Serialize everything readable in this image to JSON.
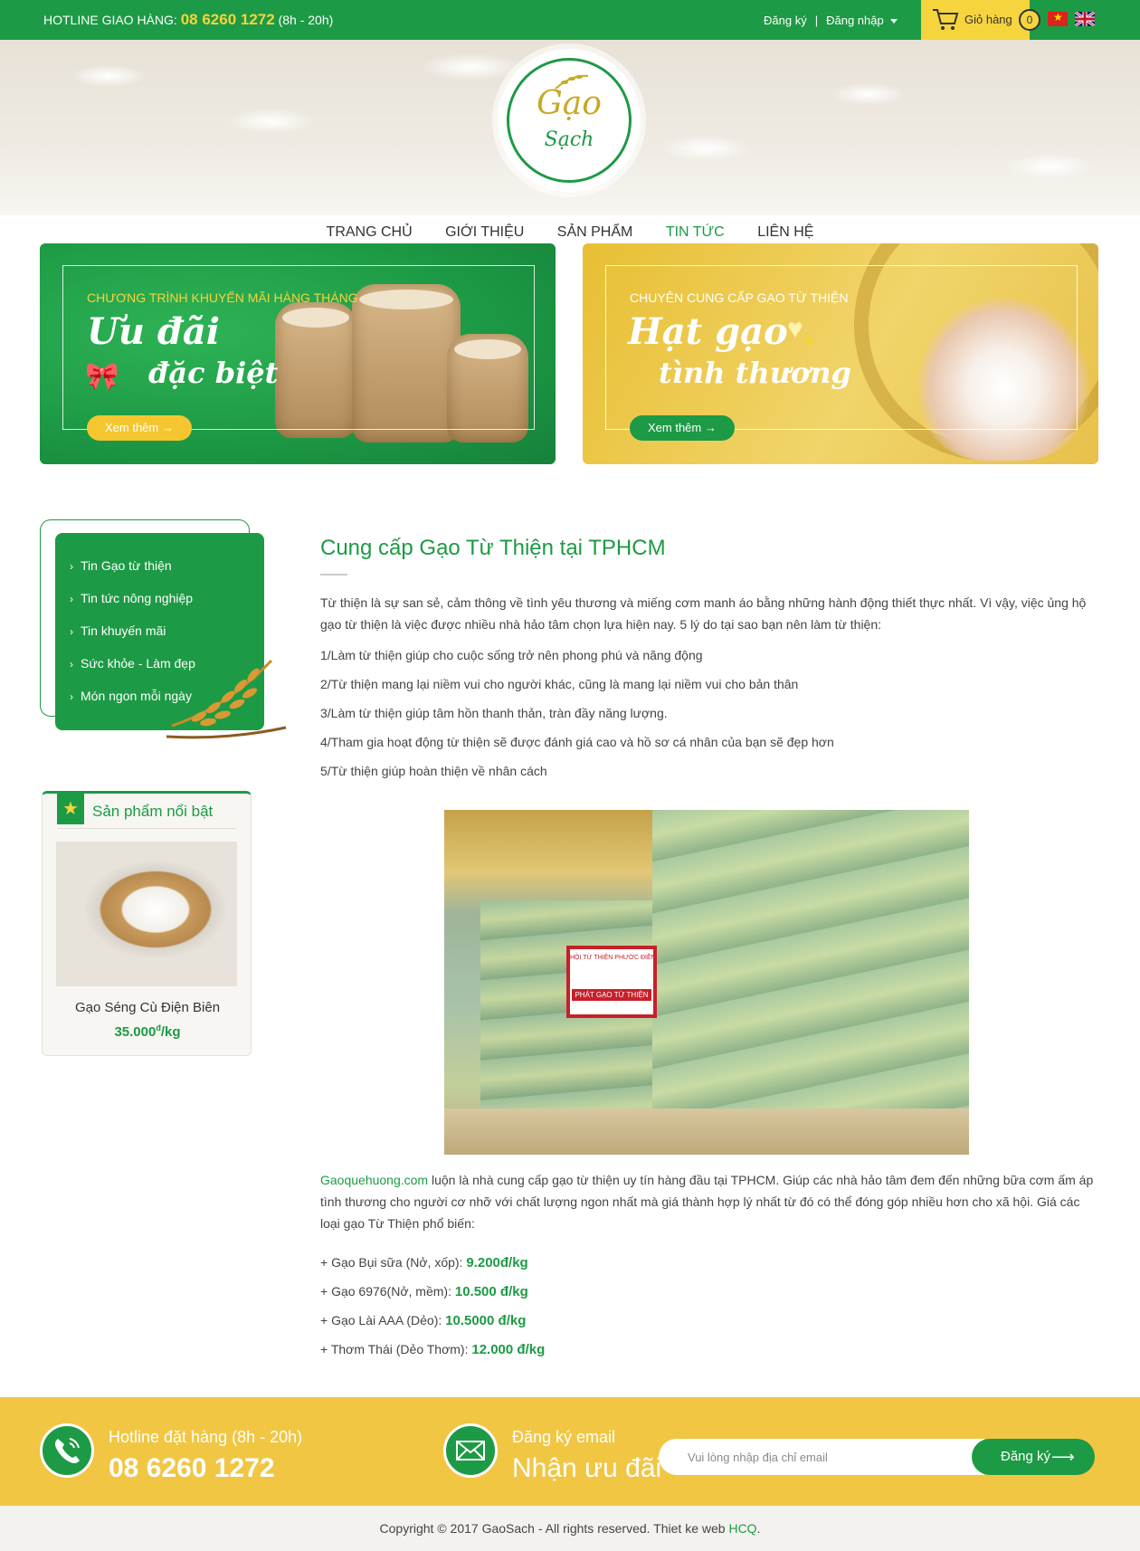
{
  "topbar": {
    "hotline_label": "HOTLINE GIAO HÀNG:",
    "hotline_number": "08 6260 1272",
    "hotline_hours": "(8h - 20h)",
    "register": "Đăng ký",
    "separator": "|",
    "login": "Đăng nhập",
    "cart_label": "Giỏ hàng",
    "cart_count": "0",
    "flag_icons": [
      "vietnam-flag-icon",
      "uk-flag-icon"
    ]
  },
  "logo": {
    "line1": "Gạo",
    "line2": "Sạch"
  },
  "nav": [
    {
      "label": "TRANG CHỦ",
      "active": false
    },
    {
      "label": "GIỚI THIỆU",
      "active": false
    },
    {
      "label": "SẢN PHẨM",
      "active": false
    },
    {
      "label": "TIN TỨC",
      "active": true
    },
    {
      "label": "LIÊN HỆ",
      "active": false
    }
  ],
  "banners": {
    "left": {
      "kicker": "CHƯƠNG TRÌNH KHUYẾN MÃI HÀNG THÁNG",
      "line1": "Ưu đãi",
      "line2": "đặc biệt",
      "button": "Xem thêm →"
    },
    "right": {
      "kicker": "CHUYÊN CUNG CẤP GẠO TỪ THIỆN",
      "line1": "Hạt gạo",
      "line2": "tình thương",
      "button": "Xem thêm →"
    }
  },
  "sidebar": {
    "menu": [
      "Tin Gạo từ thiện",
      "Tin tức nông nghiệp",
      "Tin khuyến mãi",
      "Sức khỏe - Làm đẹp",
      "Món ngon mỗi ngày"
    ],
    "featured": {
      "title": "Sản phẩm nổi bật",
      "product_name": "Gạo Séng Cù Điện Biên",
      "price": "35.000",
      "currency": "đ",
      "unit": "/kg"
    }
  },
  "article": {
    "title": "Cung cấp Gạo Từ Thiện tại TPHCM",
    "intro": "Từ thiện là sự san sẻ, cảm thông về tình yêu thương và miếng cơm manh áo bằng những hành động thiết thực nhất. Vì vậy, việc ủng hộ gạo từ thiện là việc được nhiều nhà hảo tâm chọn lựa hiện nay. 5 lý do tại sao bạn nên làm từ thiện:",
    "reasons": [
      "1/Làm từ thiện giúp cho cuộc sống trở nên phong phú và năng động",
      "2/Từ thiện mang lại niềm vui cho người khác, cũng là mang lại niềm vui cho bản thân",
      "3/Làm từ thiện giúp tâm hồn thanh thản, tràn đầy năng lượng.",
      "4/Tham gia hoạt động từ thiện sẽ được đánh giá cao và hồ sơ cá nhân của bạn sẽ đẹp hơn",
      "5/Từ thiện giúp hoàn thiện về nhân cách"
    ],
    "photo_sign_top": "HỘI TỪ THIỆN PHƯỚC ĐIỀN",
    "photo_sign_main": "PHÁT GẠO TỪ THIỆN",
    "outro_link": "Gaoquehuong.com",
    "outro_text": " luộn là nhà cung cấp gạo từ thiện uy tín hàng đầu tại TPHCM. Giúp các nhà hảo tâm đem đến những bữa cơm ấm áp tình thương cho người cơ nhỡ với chất lượng ngon nhất mà giá thành hợp lý nhất từ đó có thể đóng góp nhiều hơn cho xã hội. Giá các loại gạo Từ Thiện phổ biến:",
    "prices": [
      {
        "label": "+ Gạo Bụi sữa (Nở, xốp): ",
        "price": "9.200đ/kg"
      },
      {
        "label": "+ Gạo 6976(Nở, mềm): ",
        "price": "10.500 đ/kg"
      },
      {
        "label": "+ Gạo Lài AAA (Dẻo): ",
        "price": "10.5000 đ/kg"
      },
      {
        "label": "+ Thơm Thái (Dẻo Thơm): ",
        "price": "12.000 đ/kg"
      }
    ]
  },
  "newsletter": {
    "hotline_label": "Hotline đặt hàng (8h - 20h)",
    "hotline_number": "08 6260 1272",
    "email_label": "Đăng ký email",
    "email_big": "Nhận ưu đãi",
    "email_placeholder": "Vui lòng nhập địa chỉ email",
    "subscribe": "Đăng ký"
  },
  "footer": {
    "copyright": "Copyright © 2017 GaoSach - All rights reserved. Thiet ke web ",
    "link": "HCQ",
    "period": "."
  },
  "colors": {
    "brand_green": "#1d9a45",
    "brand_yellow": "#f5d43d",
    "newsletter_bg": "#f1c643"
  }
}
